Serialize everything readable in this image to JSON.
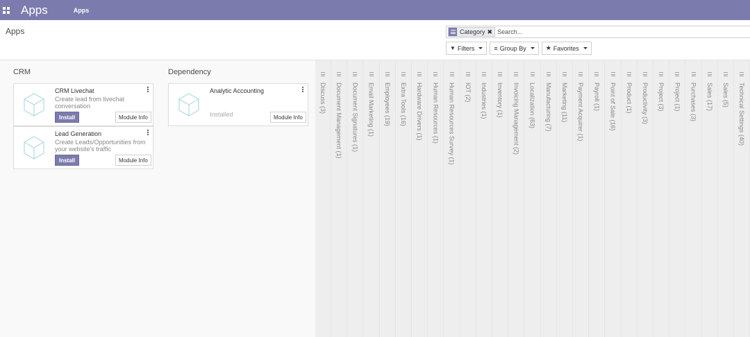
{
  "navbar": {
    "brand": "Apps",
    "menu_apps": "Apps"
  },
  "control_panel": {
    "title": "Apps",
    "search": {
      "facet_label": "Category",
      "placeholder": "Search..."
    },
    "filters_label": "Filters",
    "groupby_label": "Group By",
    "favorites_label": "Favorites"
  },
  "columns": [
    {
      "title": "CRM",
      "cards": [
        {
          "name": "CRM Livechat",
          "desc": "Create lead from livechat conversation",
          "install_label": "Install",
          "info_label": "Module Info"
        },
        {
          "name": "Lead Generation",
          "desc": "Create Leads/Opportunities from your website's traffic",
          "install_label": "Install",
          "info_label": "Module Info"
        }
      ]
    },
    {
      "title": "Dependency",
      "cards": [
        {
          "name": "Analytic Accounting",
          "status": "Installed",
          "info_label": "Module Info"
        }
      ]
    }
  ],
  "folded_columns": [
    "Discuss (3)",
    "Document Management (1)",
    "Document Signatures (1)",
    "Email Marketing (1)",
    "Employees (19)",
    "Extra Tools (16)",
    "Hardware Drivers (1)",
    "Human Resources (1)",
    "Human Resources Survey (1)",
    "IOT (2)",
    "Industries (1)",
    "Inventory (1)",
    "Invoicing Management (2)",
    "Localization (63)",
    "Manufacturing (7)",
    "Marketing (11)",
    "Payment Acquirer (1)",
    "Payroll (1)",
    "Point of Sale (16)",
    "Product (1)",
    "Productivity (3)",
    "Project (3)",
    "Project (1)",
    "Purchases (3)",
    "Sales (17)",
    "Sales (5)",
    "Technical Settings (40)"
  ],
  "colors": {
    "brand": "#7c7bad",
    "folded_bg": "#eeeeee"
  }
}
